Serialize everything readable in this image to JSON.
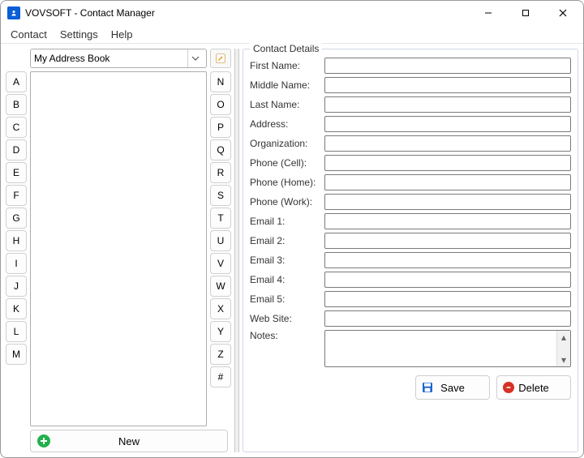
{
  "window": {
    "title": "VOVSOFT - Contact Manager"
  },
  "menu": {
    "items": [
      "Contact",
      "Settings",
      "Help"
    ]
  },
  "left": {
    "address_book_selected": "My Address Book",
    "az_left": [
      "A",
      "B",
      "C",
      "D",
      "E",
      "F",
      "G",
      "H",
      "I",
      "J",
      "K",
      "L",
      "M"
    ],
    "az_right": [
      "N",
      "O",
      "P",
      "Q",
      "R",
      "S",
      "T",
      "U",
      "V",
      "W",
      "X",
      "Y",
      "Z",
      "#"
    ],
    "new_label": "New"
  },
  "details": {
    "caption": "Contact Details",
    "fields": {
      "first_name": {
        "label": "First Name:",
        "value": ""
      },
      "middle_name": {
        "label": "Middle Name:",
        "value": ""
      },
      "last_name": {
        "label": "Last Name:",
        "value": ""
      },
      "address": {
        "label": "Address:",
        "value": ""
      },
      "organization": {
        "label": "Organization:",
        "value": ""
      },
      "phone_cell": {
        "label": "Phone (Cell):",
        "value": ""
      },
      "phone_home": {
        "label": "Phone (Home):",
        "value": ""
      },
      "phone_work": {
        "label": "Phone (Work):",
        "value": ""
      },
      "email1": {
        "label": "Email 1:",
        "value": ""
      },
      "email2": {
        "label": "Email 2:",
        "value": ""
      },
      "email3": {
        "label": "Email 3:",
        "value": ""
      },
      "email4": {
        "label": "Email 4:",
        "value": ""
      },
      "email5": {
        "label": "Email 5:",
        "value": ""
      },
      "website": {
        "label": "Web Site:",
        "value": ""
      },
      "notes": {
        "label": "Notes:",
        "value": ""
      }
    },
    "save_label": "Save",
    "delete_label": "Delete"
  }
}
